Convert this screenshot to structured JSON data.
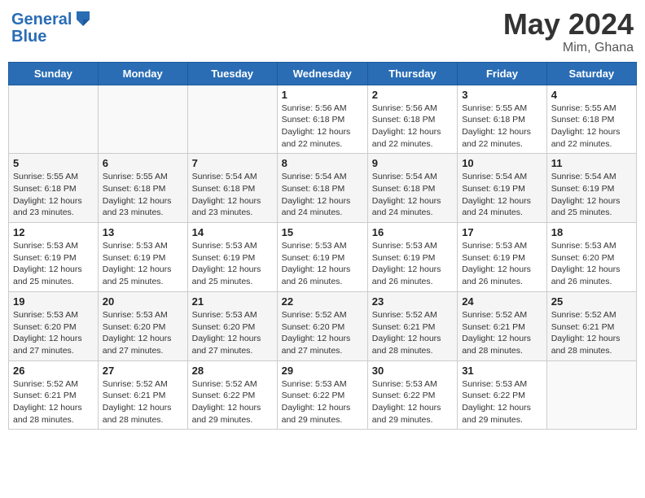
{
  "header": {
    "logo_line1": "General",
    "logo_line2": "Blue",
    "title": "May 2024",
    "subtitle": "Mim, Ghana"
  },
  "days_of_week": [
    "Sunday",
    "Monday",
    "Tuesday",
    "Wednesday",
    "Thursday",
    "Friday",
    "Saturday"
  ],
  "weeks": [
    [
      {
        "day": "",
        "info": ""
      },
      {
        "day": "",
        "info": ""
      },
      {
        "day": "",
        "info": ""
      },
      {
        "day": "1",
        "info": "Sunrise: 5:56 AM\nSunset: 6:18 PM\nDaylight: 12 hours\nand 22 minutes."
      },
      {
        "day": "2",
        "info": "Sunrise: 5:56 AM\nSunset: 6:18 PM\nDaylight: 12 hours\nand 22 minutes."
      },
      {
        "day": "3",
        "info": "Sunrise: 5:55 AM\nSunset: 6:18 PM\nDaylight: 12 hours\nand 22 minutes."
      },
      {
        "day": "4",
        "info": "Sunrise: 5:55 AM\nSunset: 6:18 PM\nDaylight: 12 hours\nand 22 minutes."
      }
    ],
    [
      {
        "day": "5",
        "info": "Sunrise: 5:55 AM\nSunset: 6:18 PM\nDaylight: 12 hours\nand 23 minutes."
      },
      {
        "day": "6",
        "info": "Sunrise: 5:55 AM\nSunset: 6:18 PM\nDaylight: 12 hours\nand 23 minutes."
      },
      {
        "day": "7",
        "info": "Sunrise: 5:54 AM\nSunset: 6:18 PM\nDaylight: 12 hours\nand 23 minutes."
      },
      {
        "day": "8",
        "info": "Sunrise: 5:54 AM\nSunset: 6:18 PM\nDaylight: 12 hours\nand 24 minutes."
      },
      {
        "day": "9",
        "info": "Sunrise: 5:54 AM\nSunset: 6:18 PM\nDaylight: 12 hours\nand 24 minutes."
      },
      {
        "day": "10",
        "info": "Sunrise: 5:54 AM\nSunset: 6:19 PM\nDaylight: 12 hours\nand 24 minutes."
      },
      {
        "day": "11",
        "info": "Sunrise: 5:54 AM\nSunset: 6:19 PM\nDaylight: 12 hours\nand 25 minutes."
      }
    ],
    [
      {
        "day": "12",
        "info": "Sunrise: 5:53 AM\nSunset: 6:19 PM\nDaylight: 12 hours\nand 25 minutes."
      },
      {
        "day": "13",
        "info": "Sunrise: 5:53 AM\nSunset: 6:19 PM\nDaylight: 12 hours\nand 25 minutes."
      },
      {
        "day": "14",
        "info": "Sunrise: 5:53 AM\nSunset: 6:19 PM\nDaylight: 12 hours\nand 25 minutes."
      },
      {
        "day": "15",
        "info": "Sunrise: 5:53 AM\nSunset: 6:19 PM\nDaylight: 12 hours\nand 26 minutes."
      },
      {
        "day": "16",
        "info": "Sunrise: 5:53 AM\nSunset: 6:19 PM\nDaylight: 12 hours\nand 26 minutes."
      },
      {
        "day": "17",
        "info": "Sunrise: 5:53 AM\nSunset: 6:19 PM\nDaylight: 12 hours\nand 26 minutes."
      },
      {
        "day": "18",
        "info": "Sunrise: 5:53 AM\nSunset: 6:20 PM\nDaylight: 12 hours\nand 26 minutes."
      }
    ],
    [
      {
        "day": "19",
        "info": "Sunrise: 5:53 AM\nSunset: 6:20 PM\nDaylight: 12 hours\nand 27 minutes."
      },
      {
        "day": "20",
        "info": "Sunrise: 5:53 AM\nSunset: 6:20 PM\nDaylight: 12 hours\nand 27 minutes."
      },
      {
        "day": "21",
        "info": "Sunrise: 5:53 AM\nSunset: 6:20 PM\nDaylight: 12 hours\nand 27 minutes."
      },
      {
        "day": "22",
        "info": "Sunrise: 5:52 AM\nSunset: 6:20 PM\nDaylight: 12 hours\nand 27 minutes."
      },
      {
        "day": "23",
        "info": "Sunrise: 5:52 AM\nSunset: 6:21 PM\nDaylight: 12 hours\nand 28 minutes."
      },
      {
        "day": "24",
        "info": "Sunrise: 5:52 AM\nSunset: 6:21 PM\nDaylight: 12 hours\nand 28 minutes."
      },
      {
        "day": "25",
        "info": "Sunrise: 5:52 AM\nSunset: 6:21 PM\nDaylight: 12 hours\nand 28 minutes."
      }
    ],
    [
      {
        "day": "26",
        "info": "Sunrise: 5:52 AM\nSunset: 6:21 PM\nDaylight: 12 hours\nand 28 minutes."
      },
      {
        "day": "27",
        "info": "Sunrise: 5:52 AM\nSunset: 6:21 PM\nDaylight: 12 hours\nand 28 minutes."
      },
      {
        "day": "28",
        "info": "Sunrise: 5:52 AM\nSunset: 6:22 PM\nDaylight: 12 hours\nand 29 minutes."
      },
      {
        "day": "29",
        "info": "Sunrise: 5:53 AM\nSunset: 6:22 PM\nDaylight: 12 hours\nand 29 minutes."
      },
      {
        "day": "30",
        "info": "Sunrise: 5:53 AM\nSunset: 6:22 PM\nDaylight: 12 hours\nand 29 minutes."
      },
      {
        "day": "31",
        "info": "Sunrise: 5:53 AM\nSunset: 6:22 PM\nDaylight: 12 hours\nand 29 minutes."
      },
      {
        "day": "",
        "info": ""
      }
    ]
  ]
}
